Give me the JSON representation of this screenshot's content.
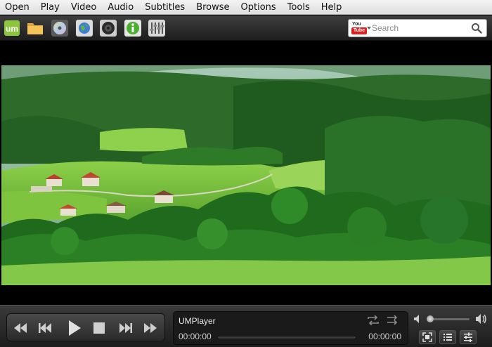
{
  "menu": [
    "Open",
    "Play",
    "Video",
    "Audio",
    "Subtitles",
    "Browse",
    "Options",
    "Tools",
    "Help"
  ],
  "toolbar": {
    "buttons": [
      "umplayer-logo-icon",
      "folder-icon",
      "disc-icon",
      "globe-icon",
      "record-icon",
      "info-icon",
      "equalizer-icon"
    ],
    "search": {
      "logo_you": "You",
      "logo_tube": "Tube",
      "placeholder": "Search"
    }
  },
  "player": {
    "title": "UMPlayer",
    "time_elapsed": "00:00:00",
    "time_total": "00:00:00"
  },
  "controls": {
    "transport": [
      "rewind-icon",
      "previous-icon",
      "play-icon",
      "stop-icon",
      "next-icon",
      "fast-forward-icon"
    ],
    "options": [
      "fullscreen-icon",
      "playlist-icon",
      "settings-icon"
    ]
  },
  "colors": {
    "accent_search_red": "#e02020",
    "video_grass": "#6ab83a",
    "video_forest": "#1f5a1e"
  }
}
